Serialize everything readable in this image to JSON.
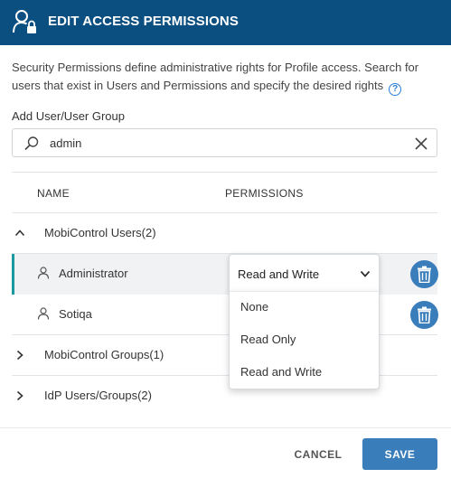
{
  "header": {
    "title": "EDIT ACCESS PERMISSIONS",
    "icon": "user-lock-icon"
  },
  "description": {
    "text": "Security Permissions define administrative rights for Profile access. Search for users that exist in Users and Permissions and specify the desired rights",
    "help_icon": "help-icon",
    "help_glyph": "?"
  },
  "add_user": {
    "label": "Add User/User Group",
    "search_value": "admin"
  },
  "table": {
    "columns": [
      "NAME",
      "PERMISSIONS"
    ],
    "groups": [
      {
        "label": "MobiControl Users(2)",
        "expanded": true,
        "users": [
          {
            "name": "Administrator",
            "permission": "Read and Write",
            "selected": true
          },
          {
            "name": "Sotiqa"
          }
        ]
      },
      {
        "label": "MobiControl Groups(1)",
        "expanded": false
      },
      {
        "label": "IdP Users/Groups(2)",
        "expanded": false
      }
    ]
  },
  "dropdown": {
    "selected": "Read and Write",
    "options": [
      "None",
      "Read Only",
      "Read and Write"
    ]
  },
  "footer": {
    "cancel_label": "CANCEL",
    "save_label": "SAVE"
  },
  "colors": {
    "header_bg": "#0b4f80",
    "primary_button": "#3a7dbb",
    "selection_accent": "#1a9aa0",
    "help_link": "#2a7fd4"
  }
}
